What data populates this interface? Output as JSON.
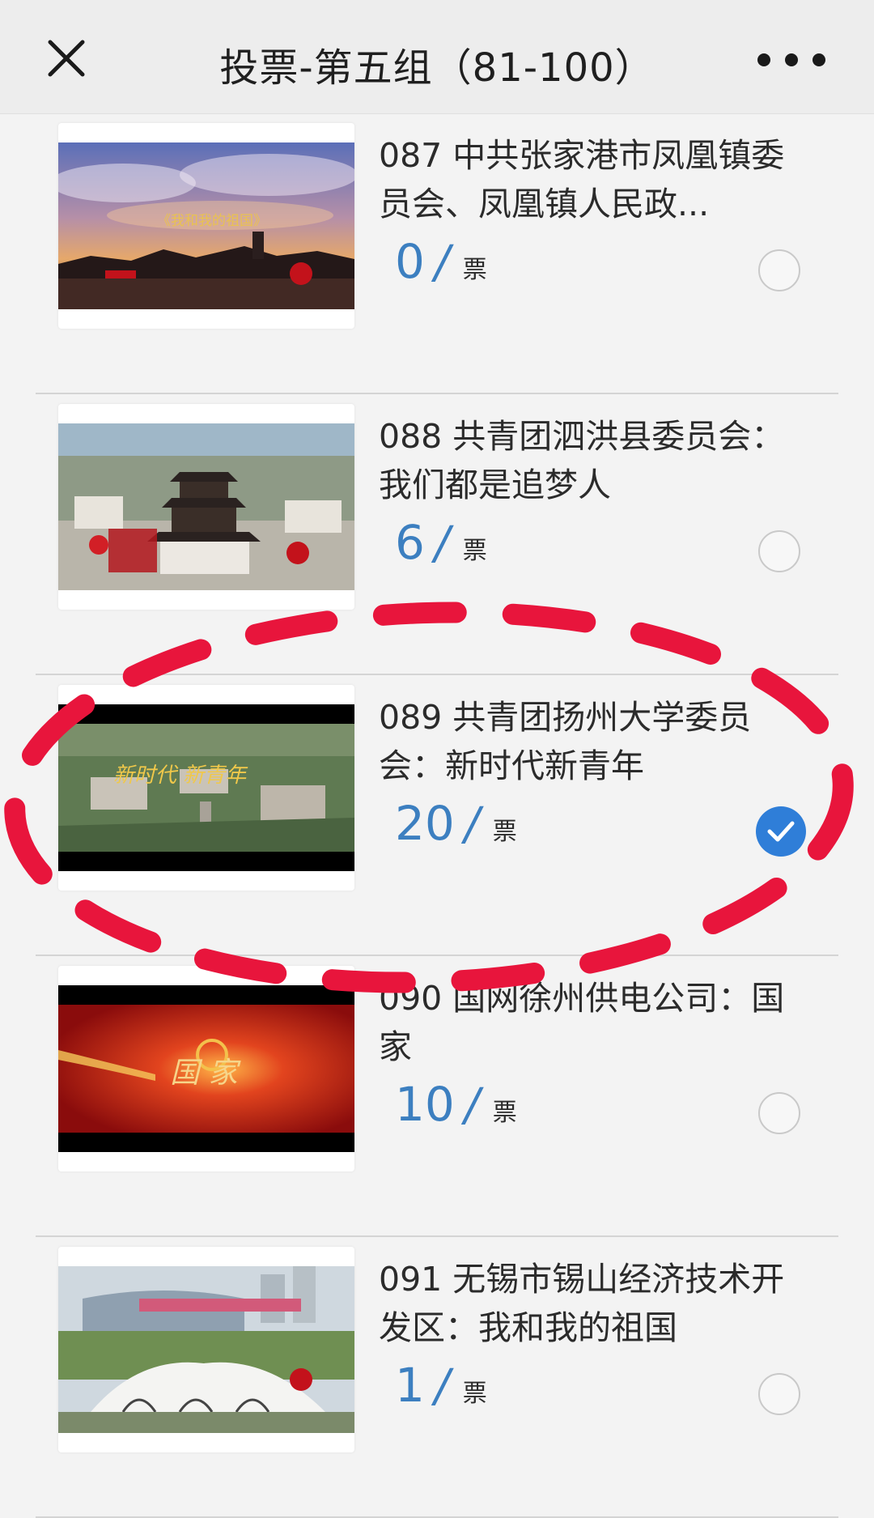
{
  "header": {
    "title": "投票-第五组（81-100）",
    "close_icon": "close-icon",
    "more_icon": "more-icon"
  },
  "vote_unit": "票",
  "items": [
    {
      "title": "087 中共张家港市凤凰镇委员会、凤凰镇人民政...",
      "votes": "0",
      "slash": "/",
      "unit": "票",
      "selected": false,
      "thumb_text": "《我和我的祖国》"
    },
    {
      "title": "088 共青团泗洪县委员会：我们都是追梦人",
      "votes": "6",
      "slash": "/",
      "unit": "票",
      "selected": false
    },
    {
      "title": "089 共青团扬州大学委员会：新时代新青年",
      "votes": "20",
      "slash": "/",
      "unit": "票",
      "selected": true,
      "thumb_text": "新时代 新青年"
    },
    {
      "title": "090 国网徐州供电公司：国家",
      "votes": "10",
      "slash": "/",
      "unit": "票",
      "selected": false,
      "thumb_text": "国 家"
    },
    {
      "title": "091 无锡市锡山经济技术开发区：我和我的祖国",
      "votes": "1",
      "slash": "/",
      "unit": "票",
      "selected": false
    }
  ],
  "colors": {
    "accent": "#3c7fc0",
    "check": "#2f7ed8",
    "annotation": "#e8153c"
  }
}
